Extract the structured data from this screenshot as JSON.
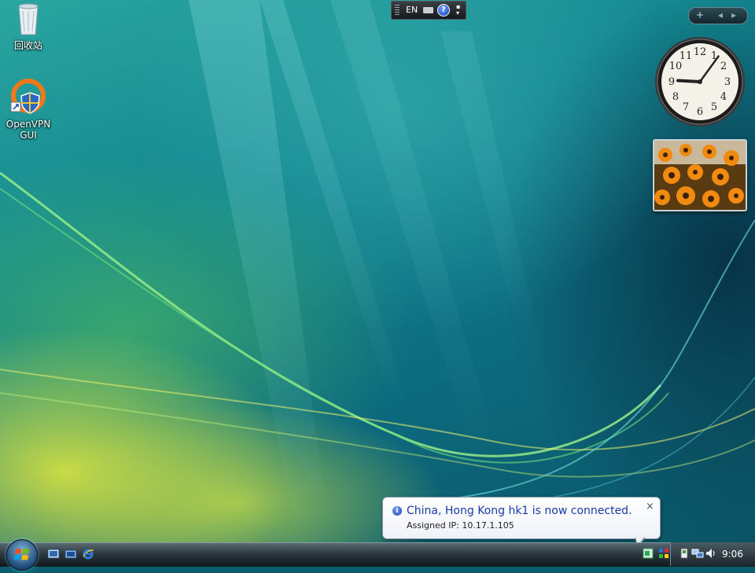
{
  "desktop_icons": [
    {
      "label": "回收站",
      "icon": "recycle-bin-icon"
    },
    {
      "label": "OpenVPN GUI",
      "icon": "openvpn-icon"
    }
  ],
  "language_bar": {
    "lang": "EN",
    "keyboard_icon": "keyboard-icon",
    "help_icon": "help-icon"
  },
  "sidebar": {
    "add_label": "+",
    "prev_label": "◂",
    "next_label": "▸",
    "clock": {
      "hour": 9,
      "minute": 6
    },
    "slideshow": {
      "theme": "orange-flowers"
    }
  },
  "notification": {
    "title": "China, Hong Kong hk1 is now connected.",
    "body": "Assigned IP: 10.17.1.105",
    "close": "×",
    "icon": "info-icon"
  },
  "taskbar": {
    "quicklaunch": [
      "show-desktop-icon",
      "switch-windows-icon",
      "internet-explorer-icon"
    ],
    "tray_icons": [
      "openvpn-tray-icon",
      "network-icon",
      "safely-remove-icon",
      "network-connections-icon",
      "volume-icon"
    ],
    "clock": "9:06"
  }
}
